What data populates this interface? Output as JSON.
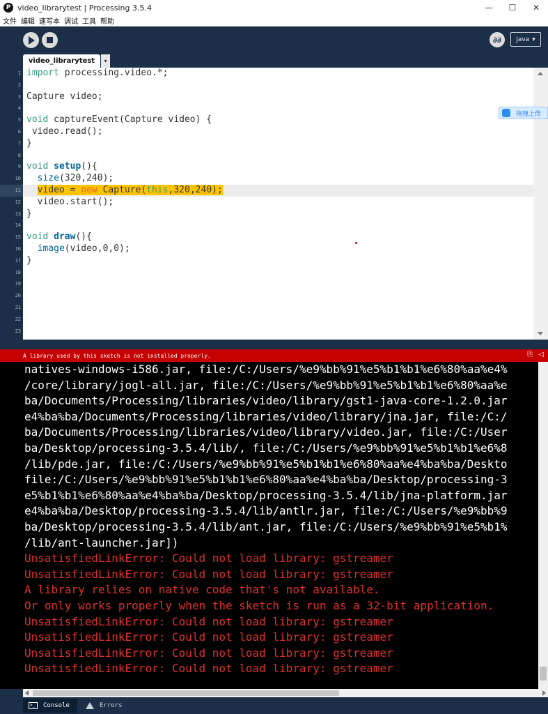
{
  "window": {
    "title": "video_librarytest | Processing 3.5.4",
    "app_icon_glyph": "P",
    "controls": [
      "—",
      "☐",
      "✕"
    ]
  },
  "menu": [
    "文件",
    "编辑",
    "速写本",
    "调试",
    "工具",
    "帮助"
  ],
  "toolbar": {
    "run": "run-icon",
    "stop": "stop-icon",
    "mode_icon_glyph": "∂∂",
    "mode_label": "Java",
    "mode_arrow": "▾"
  },
  "tab": {
    "name": "video_librarytest",
    "menu_arrow": "▾"
  },
  "editor": {
    "line_numbers": [
      "1",
      "2",
      "3",
      "4",
      "5",
      "6",
      "7",
      "8",
      "9",
      "10",
      "11",
      "12",
      "13",
      "14",
      "15",
      "16",
      "17",
      "18",
      "19",
      "20",
      "21",
      "22",
      "23"
    ],
    "highlight_line": 11,
    "lines": [
      {
        "text": "import processing.video.*;"
      },
      {
        "text": ""
      },
      {
        "text": "Capture video;"
      },
      {
        "text": ""
      },
      {
        "text": "void captureEvent(Capture video) {"
      },
      {
        "text": " video.read();"
      },
      {
        "text": "}"
      },
      {
        "text": ""
      },
      {
        "text": "void setup(){"
      },
      {
        "text": "  size(320,240);"
      },
      {
        "text": "  video = new Capture(this,320,240);"
      },
      {
        "text": "  video.start();"
      },
      {
        "text": "}"
      },
      {
        "text": ""
      },
      {
        "text": "void draw(){"
      },
      {
        "text": "  image(video,0,0);"
      },
      {
        "text": "}"
      }
    ]
  },
  "upload_widget": {
    "label": "拖拽上传"
  },
  "error_bar": {
    "message": "A library used by this sketch is not installed properly.",
    "icons": [
      "⎘",
      "◁"
    ]
  },
  "console": {
    "lines": [
      {
        "text": "natives-windows-i586.jar, file:/C:/Users/%e9%bb%91%e5%b1%b1%e6%80%aa%e4%",
        "type": "out"
      },
      {
        "text": "/core/library/jogl-all.jar, file:/C:/Users/%e9%bb%91%e5%b1%b1%e6%80%aa%e",
        "type": "out"
      },
      {
        "text": "ba/Documents/Processing/libraries/video/library/gst1-java-core-1.2.0.jar",
        "type": "out"
      },
      {
        "text": "e4%ba%ba/Documents/Processing/libraries/video/library/jna.jar, file:/C:/",
        "type": "out"
      },
      {
        "text": "ba/Documents/Processing/libraries/video/library/video.jar, file:/C:/User",
        "type": "out"
      },
      {
        "text": "ba/Desktop/processing-3.5.4/lib/, file:/C:/Users/%e9%bb%91%e5%b1%b1%e6%8",
        "type": "out"
      },
      {
        "text": "/lib/pde.jar, file:/C:/Users/%e9%bb%91%e5%b1%b1%e6%80%aa%e4%ba%ba/Deskto",
        "type": "out"
      },
      {
        "text": "file:/C:/Users/%e9%bb%91%e5%b1%b1%e6%80%aa%e4%ba%ba/Desktop/processing-3",
        "type": "out"
      },
      {
        "text": "e5%b1%b1%e6%80%aa%e4%ba%ba/Desktop/processing-3.5.4/lib/jna-platform.jar",
        "type": "out"
      },
      {
        "text": "e4%ba%ba/Desktop/processing-3.5.4/lib/antlr.jar, file:/C:/Users/%e9%bb%9",
        "type": "out"
      },
      {
        "text": "ba/Desktop/processing-3.5.4/lib/ant.jar, file:/C:/Users/%e9%bb%91%e5%b1%",
        "type": "out"
      },
      {
        "text": "/lib/ant-launcher.jar])",
        "type": "out"
      },
      {
        "text": "UnsatisfiedLinkError: Could not load library: gstreamer",
        "type": "err"
      },
      {
        "text": "UnsatisfiedLinkError: Could not load library: gstreamer",
        "type": "err"
      },
      {
        "text": "A library relies on native code that's not available.",
        "type": "err"
      },
      {
        "text": "Or only works properly when the sketch is run as a 32-bit application.",
        "type": "err"
      },
      {
        "text": "UnsatisfiedLinkError: Could not load library: gstreamer",
        "type": "err"
      },
      {
        "text": "UnsatisfiedLinkError: Could not load library: gstreamer",
        "type": "err"
      },
      {
        "text": "UnsatisfiedLinkError: Could not load library: gstreamer",
        "type": "err"
      },
      {
        "text": "UnsatisfiedLinkError: Could not load library: gstreamer",
        "type": "err"
      }
    ]
  },
  "footer": {
    "console_label": "Console",
    "errors_label": "Errors"
  },
  "colors": {
    "chrome": "#1b2f48",
    "error_bar": "#c60000",
    "highlight": "#ffc400",
    "console_error": "#e0302e"
  }
}
